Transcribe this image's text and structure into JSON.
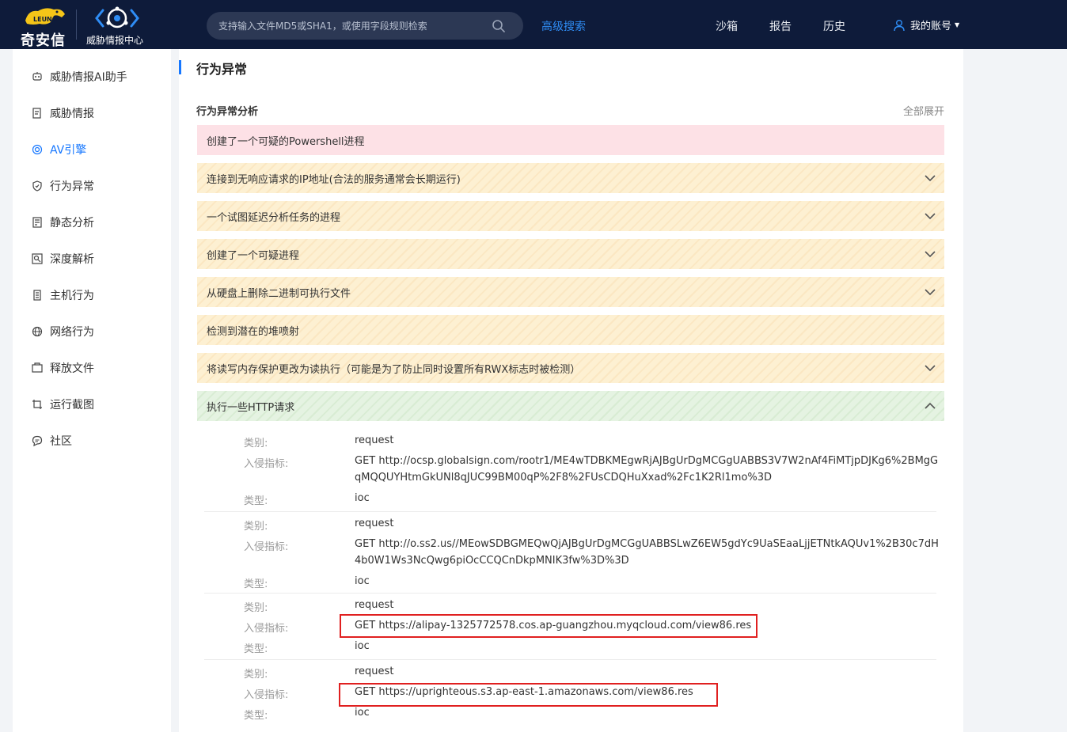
{
  "header": {
    "brand_name": "奇安信",
    "mascot_text": "LEUNG",
    "product_name": "威胁情报中心",
    "search_placeholder": "支持输入文件MD5或SHA1，或使用字段规则检索",
    "advanced_search": "高级搜索",
    "nav": [
      "沙箱",
      "报告",
      "历史"
    ],
    "account": "我的账号"
  },
  "sidebar": {
    "items": [
      {
        "label": "威胁情报AI助手",
        "icon": "ai-assistant-icon"
      },
      {
        "label": "威胁情报",
        "icon": "threat-intel-icon"
      },
      {
        "label": "AV引擎",
        "icon": "av-engine-icon",
        "active": true
      },
      {
        "label": "行为异常",
        "icon": "shield-icon"
      },
      {
        "label": "静态分析",
        "icon": "static-analysis-icon"
      },
      {
        "label": "深度解析",
        "icon": "deep-analysis-icon"
      },
      {
        "label": "主机行为",
        "icon": "host-behavior-icon"
      },
      {
        "label": "网络行为",
        "icon": "network-globe-icon"
      },
      {
        "label": "释放文件",
        "icon": "dropped-file-icon"
      },
      {
        "label": "运行截图",
        "icon": "screenshot-icon"
      },
      {
        "label": "社区",
        "icon": "community-chat-icon"
      }
    ]
  },
  "main": {
    "title": "行为异常",
    "section_title": "行为异常分析",
    "expand_all": "全部展开",
    "items": [
      {
        "label": "创建了一个可疑的Powershell进程",
        "severity": "high",
        "expandable": false
      },
      {
        "label": "连接到无响应请求的IP地址(合法的服务通常会长期运行)",
        "severity": "medium",
        "expandable": true
      },
      {
        "label": "一个试图延迟分析任务的进程",
        "severity": "medium",
        "expandable": true
      },
      {
        "label": "创建了一个可疑进程",
        "severity": "medium",
        "expandable": true
      },
      {
        "label": "从硬盘上删除二进制可执行文件",
        "severity": "medium",
        "expandable": true
      },
      {
        "label": "检测到潜在的堆喷射",
        "severity": "medium",
        "expandable": false
      },
      {
        "label": "将读写内存保护更改为读执行（可能是为了防止同时设置所有RWX标志时被检测）",
        "severity": "medium",
        "expandable": true
      },
      {
        "label": "执行一些HTTP请求",
        "severity": "low",
        "expandable": true,
        "expanded": true
      }
    ],
    "detail_labels": {
      "category": "类别:",
      "indicator": "入侵指标:",
      "type": "类型:"
    },
    "http_requests": [
      {
        "category": "request",
        "indicator": "GET http://ocsp.globalsign.com/rootr1/ME4wTDBKMEgwRjAJBgUrDgMCGgUABBS3V7W2nAf4FiMTjpDJKg6%2BMgGqMQQUYHtmGkUNl8qJUC99BM00qP%2F8%2FUsCDQHuXxad%2Fc1K2Rl1mo%3D",
        "type": "ioc",
        "highlighted": false
      },
      {
        "category": "request",
        "indicator": "GET http://o.ss2.us//MEowSDBGMEQwQjAJBgUrDgMCGgUABBSLwZ6EW5gdYc9UaSEaaLjjETNtkAQUv1%2B30c7dH4b0W1Ws3NcQwg6piOcCCQCnDkpMNIK3fw%3D%3D",
        "type": "ioc",
        "highlighted": false
      },
      {
        "category": "request",
        "indicator": "GET https://alipay-1325772578.cos.ap-guangzhou.myqcloud.com/view86.res",
        "type": "ioc",
        "highlighted": true
      },
      {
        "category": "request",
        "indicator": "GET https://uprighteous.s3.ap-east-1.amazonaws.com/view86.res",
        "type": "ioc",
        "highlighted": true
      }
    ]
  },
  "colors": {
    "topbar": "#0e1b3a",
    "accent": "#1677ff",
    "severity_high_bg": "#fde1e6",
    "severity_medium_bg": "#fdf0d2",
    "severity_low_bg": "#e5f3e2",
    "highlight_box": "#e02020"
  }
}
